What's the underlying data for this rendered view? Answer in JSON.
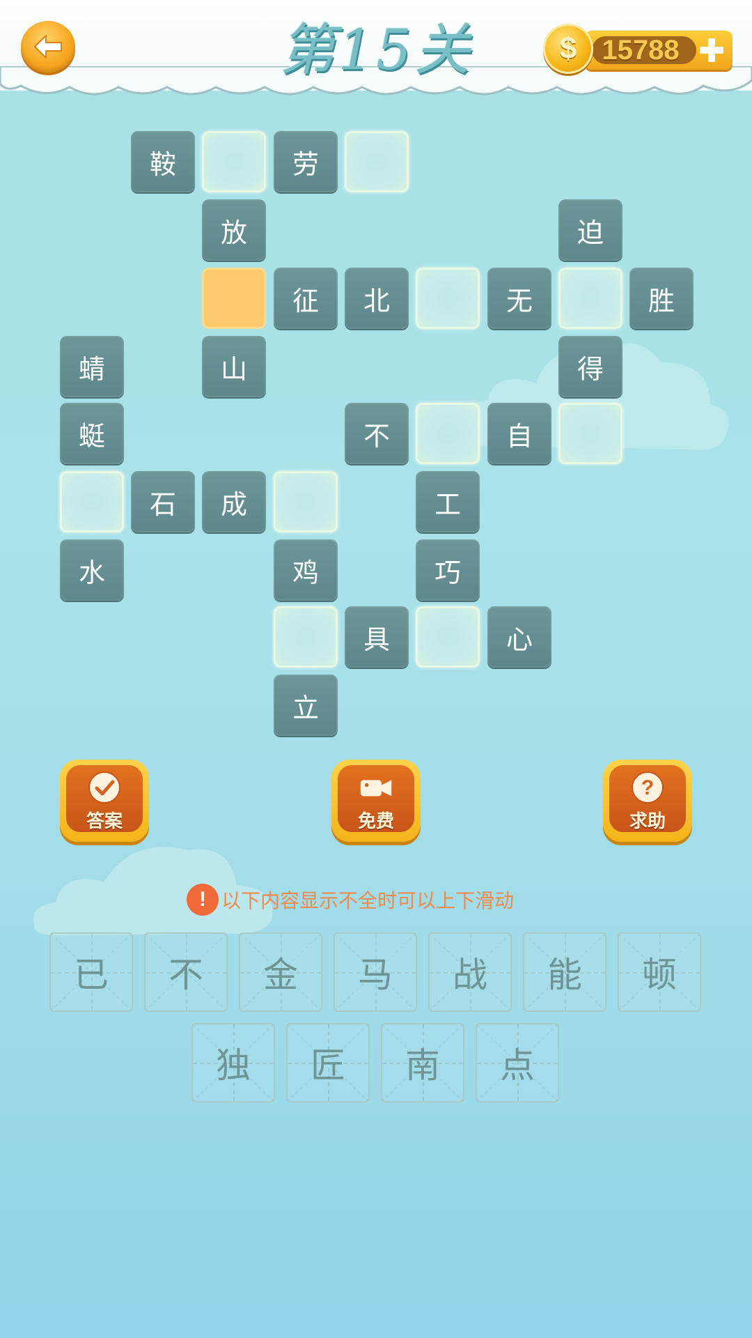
{
  "header": {
    "title": "第15关",
    "coins": "15788",
    "coin_symbol": "$",
    "back_icon": "back-arrow-icon",
    "plus_icon": "plus-icon"
  },
  "grid": {
    "cells": [
      {
        "char": "鞍",
        "state": "filled"
      },
      {
        "char": "",
        "state": "empty"
      },
      {
        "char": "劳",
        "state": "filled"
      },
      {
        "char": "",
        "state": "empty"
      },
      {
        "char": "放",
        "state": "filled"
      },
      {
        "char": "迫",
        "state": "filled"
      },
      {
        "char": "",
        "state": "selected"
      },
      {
        "char": "征",
        "state": "filled"
      },
      {
        "char": "北",
        "state": "filled"
      },
      {
        "char": "",
        "state": "empty"
      },
      {
        "char": "无",
        "state": "filled"
      },
      {
        "char": "",
        "state": "empty"
      },
      {
        "char": "胜",
        "state": "filled"
      },
      {
        "char": "蜻",
        "state": "filled"
      },
      {
        "char": "山",
        "state": "filled"
      },
      {
        "char": "得",
        "state": "filled"
      },
      {
        "char": "蜓",
        "state": "filled"
      },
      {
        "char": "不",
        "state": "filled"
      },
      {
        "char": "",
        "state": "empty"
      },
      {
        "char": "自",
        "state": "filled"
      },
      {
        "char": "",
        "state": "empty"
      },
      {
        "char": "",
        "state": "empty"
      },
      {
        "char": "石",
        "state": "filled"
      },
      {
        "char": "成",
        "state": "filled"
      },
      {
        "char": "",
        "state": "empty"
      },
      {
        "char": "工",
        "state": "filled"
      },
      {
        "char": "水",
        "state": "filled"
      },
      {
        "char": "鸡",
        "state": "filled"
      },
      {
        "char": "巧",
        "state": "filled"
      },
      {
        "char": "",
        "state": "empty"
      },
      {
        "char": "具",
        "state": "filled"
      },
      {
        "char": "",
        "state": "empty"
      },
      {
        "char": "心",
        "state": "filled"
      },
      {
        "char": "立",
        "state": "filled"
      }
    ]
  },
  "actions": {
    "answer_label": "答案",
    "free_label": "免费",
    "help_label": "求助"
  },
  "notice": {
    "icon": "!",
    "text": "以下内容显示不全时可以上下滑动"
  },
  "choices": {
    "row1": [
      "已",
      "不",
      "金",
      "马",
      "战",
      "能",
      "顿"
    ],
    "row2": [
      "独",
      "匠",
      "南",
      "点"
    ]
  },
  "colors": {
    "tile_filled": "#6a9396",
    "tile_selected": "#ffc970",
    "accent_orange": "#f5a623",
    "notice_text": "#ef8a4c"
  }
}
